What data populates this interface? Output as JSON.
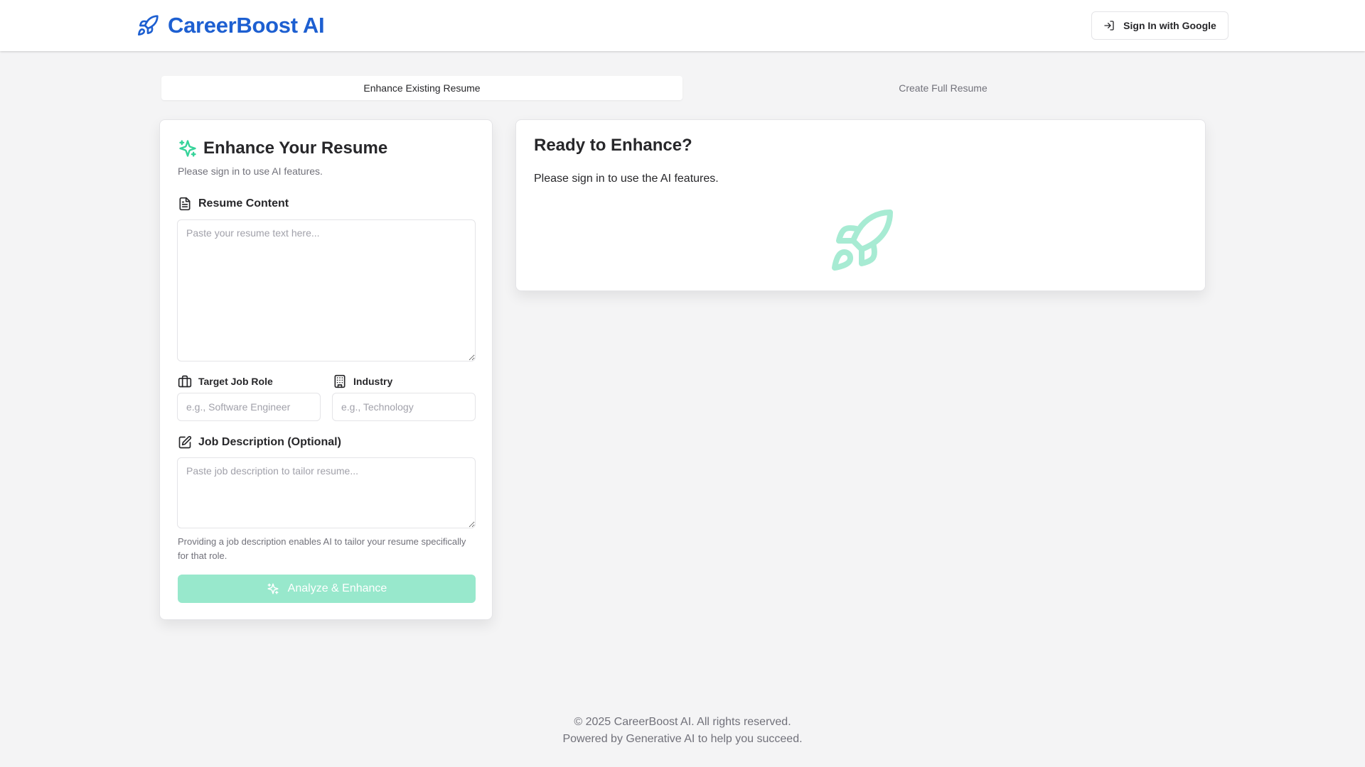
{
  "colors": {
    "brand": "#1d5fd1",
    "accent": "#34d399",
    "button_disabled": "#98e8cc",
    "background": "#f4f4f5"
  },
  "header": {
    "app_name": "CareerBoost AI",
    "logo_icon": "rocket-icon",
    "signin_label": "Sign In with Google",
    "signin_icon": "log-in-icon"
  },
  "tabs": [
    {
      "label": "Enhance Existing Resume",
      "active": true
    },
    {
      "label": "Create Full Resume",
      "active": false
    }
  ],
  "enhance_form": {
    "title": "Enhance Your Resume",
    "title_icon": "sparkles-icon",
    "subtitle": "Please sign in to use AI features.",
    "resume_label": "Resume Content",
    "resume_icon": "file-text-icon",
    "resume_placeholder": "Paste your resume text here...",
    "job_role_label": "Target Job Role",
    "job_role_icon": "briefcase-icon",
    "job_role_placeholder": "e.g., Software Engineer",
    "industry_label": "Industry",
    "industry_icon": "building-icon",
    "industry_placeholder": "e.g., Technology",
    "job_desc_label": "Job Description (Optional)",
    "job_desc_icon": "edit-icon",
    "job_desc_placeholder": "Paste job description to tailor resume...",
    "helper_text": "Providing a job description enables AI to tailor your resume specifically for that role.",
    "submit_label": "Analyze & Enhance",
    "submit_icon": "sparkles-icon"
  },
  "ready_panel": {
    "title": "Ready to Enhance?",
    "text": "Please sign in to use the AI features.",
    "illustration_icon": "rocket-icon"
  },
  "footer": {
    "copyright": "© 2025 CareerBoost AI. All rights reserved.",
    "tagline": "Powered by Generative AI to help you succeed."
  }
}
